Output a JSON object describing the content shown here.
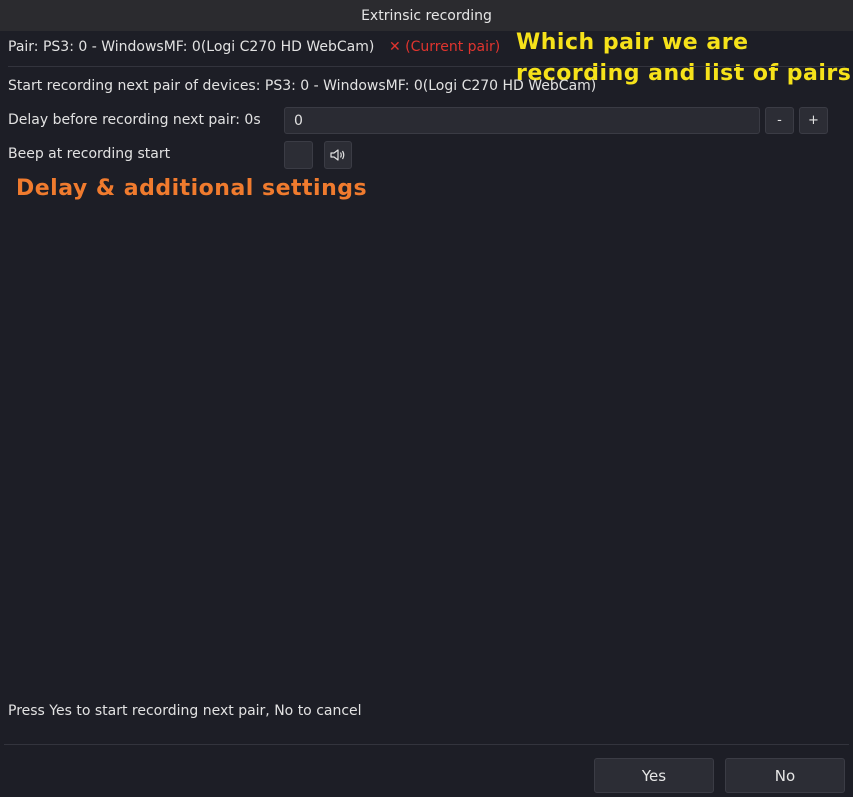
{
  "window": {
    "title": "Extrinsic recording"
  },
  "pair": {
    "label": "Pair: PS3: 0 - WindowsMF: 0(Logi C270 HD WebCam)",
    "current_marker": "✕ (Current pair)",
    "current_color": "#e0342e"
  },
  "next_pair": {
    "label": "Start recording next pair of devices: PS3: 0 - WindowsMF: 0(Logi C270 HD WebCam)"
  },
  "delay": {
    "label": "Delay before recording next pair: 0s",
    "value": "0",
    "decrement_label": "-",
    "increment_label": "+"
  },
  "beep": {
    "label": "Beep at recording start",
    "checked": false,
    "icon": "speaker-icon"
  },
  "annotations": {
    "pair_note_line1": "Which pair we are",
    "pair_note_line2": "recording and list of pairs",
    "pair_note_color": "#f6e21a",
    "settings_note": "Delay & additional settings",
    "settings_note_color": "#f07b2e"
  },
  "prompt": {
    "text": "Press Yes to start recording next pair, No to cancel"
  },
  "buttons": {
    "yes": "Yes",
    "no": "No"
  }
}
